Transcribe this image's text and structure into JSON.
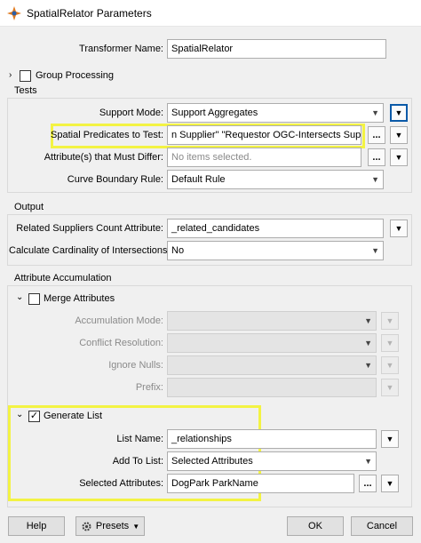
{
  "window": {
    "title": "SpatialRelator Parameters"
  },
  "transformer_name": {
    "label": "Transformer Name:",
    "value": "SpatialRelator"
  },
  "group_processing": {
    "label": "Group Processing"
  },
  "tests": {
    "title": "Tests",
    "support_mode": {
      "label": "Support Mode:",
      "value": "Support Aggregates"
    },
    "spatial_predicates": {
      "label": "Spatial Predicates to Test:",
      "value": "n Supplier\" \"Requestor OGC-Intersects Supplier\""
    },
    "attributes_differ": {
      "label": "Attribute(s) that Must Differ:",
      "placeholder": "No items selected."
    },
    "curve_boundary": {
      "label": "Curve Boundary Rule:",
      "value": "Default Rule"
    }
  },
  "output": {
    "title": "Output",
    "related_count": {
      "label": "Related Suppliers Count Attribute:",
      "value": "_related_candidates"
    },
    "cardinality": {
      "label": "Calculate Cardinality of Intersections:",
      "value": "No"
    }
  },
  "attribute_accumulation": {
    "title": "Attribute Accumulation",
    "merge_attributes": {
      "label": "Merge Attributes",
      "checked": false
    },
    "accumulation_mode": {
      "label": "Accumulation Mode:"
    },
    "conflict_resolution": {
      "label": "Conflict Resolution:"
    },
    "ignore_nulls": {
      "label": "Ignore Nulls:"
    },
    "prefix": {
      "label": "Prefix:"
    },
    "generate_list": {
      "label": "Generate List",
      "checked": true,
      "list_name": {
        "label": "List Name:",
        "value": "_relationships"
      },
      "add_to_list": {
        "label": "Add To List:",
        "value": "Selected Attributes"
      },
      "selected_attributes": {
        "label": "Selected Attributes:",
        "value": "DogPark ParkName"
      }
    }
  },
  "footer": {
    "help": "Help",
    "presets": "Presets",
    "ok": "OK",
    "cancel": "Cancel"
  },
  "colors": {
    "highlight": "#f3f343",
    "focus_blue": "#0b5aa8"
  }
}
